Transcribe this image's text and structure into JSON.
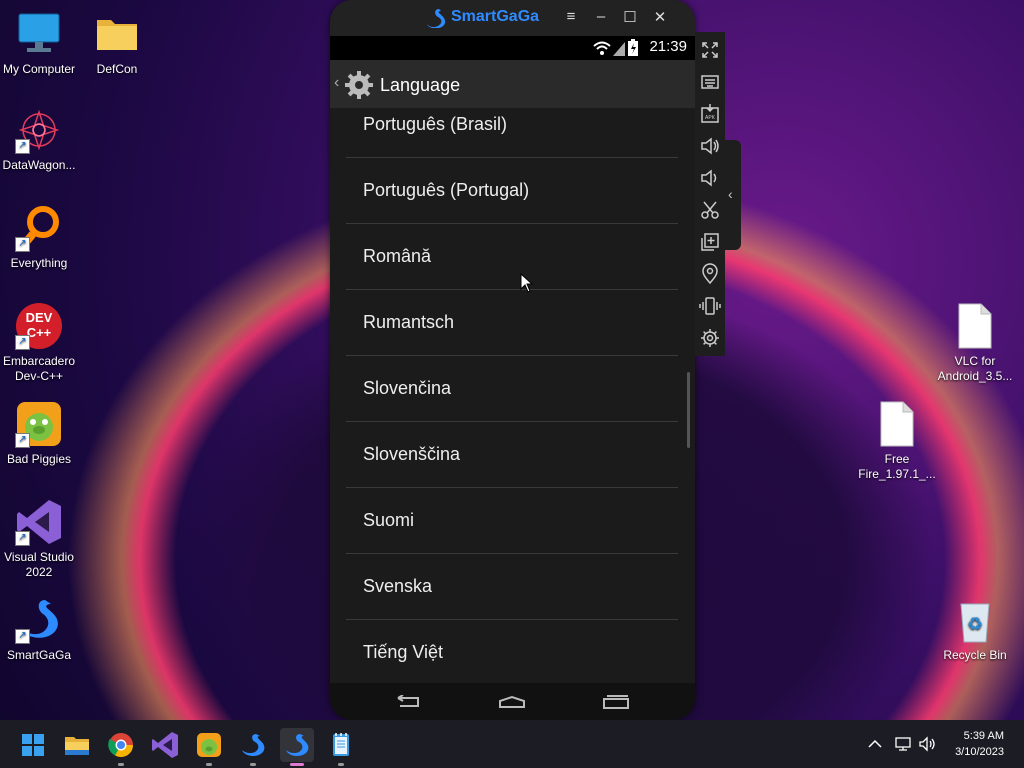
{
  "desktop": {
    "icons": [
      {
        "label": "My Computer"
      },
      {
        "label": "DefCon"
      },
      {
        "label": "DataWagon..."
      },
      {
        "label": "Everything"
      },
      {
        "label": "Embarcadero Dev-C++"
      },
      {
        "label": "Bad Piggies"
      },
      {
        "label": "Visual Studio 2022"
      },
      {
        "label": "SmartGaGa"
      },
      {
        "label": "VLC for Android_3.5..."
      },
      {
        "label": "Free Fire_1.97.1_..."
      },
      {
        "label": "Recycle Bin"
      }
    ],
    "devcpp_icon_text": "DEV C++"
  },
  "emulator": {
    "brand": "SmartGaGa",
    "status_time": "21:39",
    "screen_title": "Language",
    "languages": [
      "Português (Brasil)",
      "Português (Portugal)",
      "Română",
      "Rumantsch",
      "Slovenčina",
      "Slovenščina",
      "Suomi",
      "Svenska",
      "Tiếng Việt"
    ],
    "toolbar_icons": [
      "fullscreen-icon",
      "keyboard-icon",
      "apk-install-icon",
      "volume-up-icon",
      "volume-down-icon",
      "screenshot-cut-icon",
      "multi-instance-icon",
      "location-icon",
      "shake-icon",
      "settings-icon"
    ]
  },
  "taskbar": {
    "time": "5:39 AM",
    "date": "3/10/2023"
  },
  "colors": {
    "accent": "#2e8bff",
    "taskbar": "#1c1c24"
  }
}
